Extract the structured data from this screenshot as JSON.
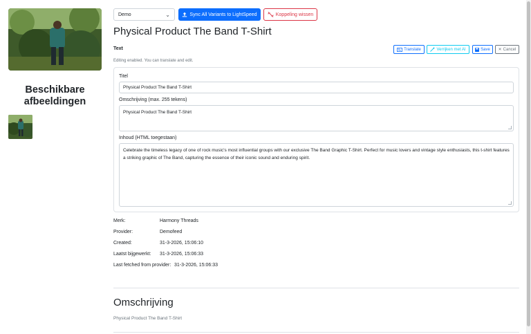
{
  "left": {
    "available_images_title": "Beschikbare afbeeldingen"
  },
  "toolbar": {
    "select_value": "Demo",
    "sync_label": "Sync All Variants to LightSpeed",
    "unlink_label": "Koppeling wissen"
  },
  "product": {
    "title": "Physical Product The Band T-Shirt"
  },
  "text_section": {
    "label": "Text",
    "translate_label": "Translate",
    "enrich_label": "Verrijken met AI",
    "save_label": "Save",
    "cancel_label": "Cancel",
    "editing_note": "Editing enabled. You can translate and edit."
  },
  "form": {
    "title_label": "Titel",
    "title_value": "Physical Product The Band T-Shirt",
    "description_label": "Omschrijving (max. 255 tekens)",
    "description_value": "Physical Product The Band T-Shirt",
    "content_label": "Inhoud (HTML toegestaan)",
    "content_value": "Celebrate the timeless legacy of one of rock music's most influential groups with our exclusive The Band Graphic T-Shirt. Perfect for music lovers and vintage style enthusiasts, this t-shirt features a striking graphic of The Band, capturing the essence of their iconic sound and enduring spirit."
  },
  "meta": {
    "brand_label": "Merk:",
    "brand_value": "Harmony Threads",
    "provider_label": "Provider:",
    "provider_value": "Demofeed",
    "created_label": "Created:",
    "created_value": "31-3-2026, 15:06:10",
    "updated_label": "Laatst bijgewerkt:",
    "updated_value": "31-3-2026, 15:06:33",
    "fetched_label": "Last fetched from provider:",
    "fetched_value": "31-3-2026, 15:06:33"
  },
  "description_section": {
    "title": "Omschrijving",
    "text": "Physical Product The Band T-Shirt"
  },
  "colors": {
    "primary": "#0d6efd",
    "danger": "#dc3545",
    "info": "#0dcaf0",
    "secondary": "#6c757d"
  },
  "icons": [
    "chevron-down-icon",
    "upload-icon",
    "unlink-icon",
    "translate-icon",
    "magic-wand-icon",
    "save-icon",
    "close-icon"
  ]
}
